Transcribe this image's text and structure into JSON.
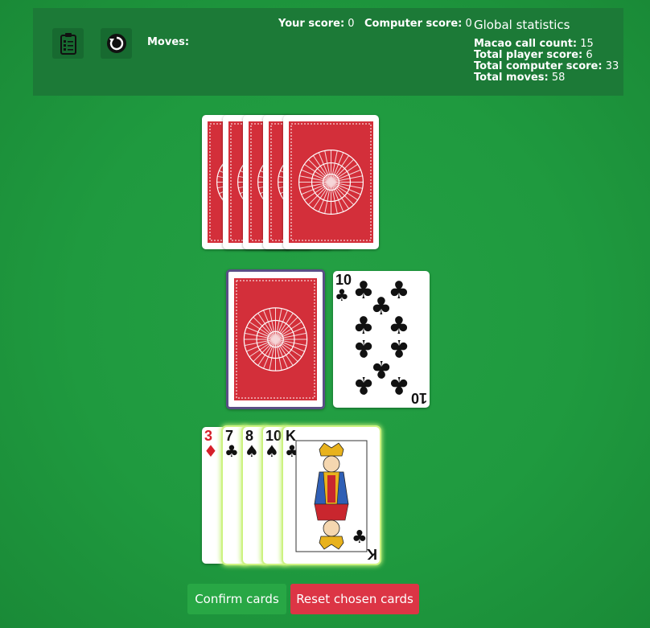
{
  "toolbar": {
    "rules_icon": "clipboard-list-icon",
    "restart_icon": "restart-icon",
    "moves_label": "Moves:"
  },
  "scores": {
    "player_label": "Your score:",
    "player_value": "0",
    "computer_label": "Computer score:",
    "computer_value": "0"
  },
  "global_stats": {
    "title": "Global statistics",
    "macao_label": "Macao call count:",
    "macao_value": "15",
    "player_total_label": "Total player score:",
    "player_total_value": "6",
    "computer_total_label": "Total computer score:",
    "computer_total_value": "33",
    "moves_total_label": "Total moves:",
    "moves_total_value": "58"
  },
  "opponent_hand": {
    "card_count": 5,
    "face": "down"
  },
  "draw_pile": {
    "face": "down"
  },
  "discard_pile": {
    "rank": "10",
    "suit": "♣",
    "color": "black"
  },
  "player_hand": [
    {
      "rank": "3",
      "suit": "♦",
      "color": "red",
      "selected": false
    },
    {
      "rank": "7",
      "suit": "♣",
      "color": "black",
      "selected": true
    },
    {
      "rank": "8",
      "suit": "♠",
      "color": "black",
      "selected": true
    },
    {
      "rank": "10",
      "suit": "♠",
      "color": "black",
      "selected": true
    },
    {
      "rank": "K",
      "suit": "♣",
      "color": "black",
      "selected": true
    }
  ],
  "actions": {
    "confirm_label": "Confirm cards",
    "reset_label": "Reset chosen cards"
  },
  "colors": {
    "table": "#1f9a3f",
    "topbar": "#1c7a37",
    "card_back": "#d32f3a",
    "confirm": "#28a745",
    "reset": "#dc3545",
    "selected_glow": "#c8f27a"
  }
}
